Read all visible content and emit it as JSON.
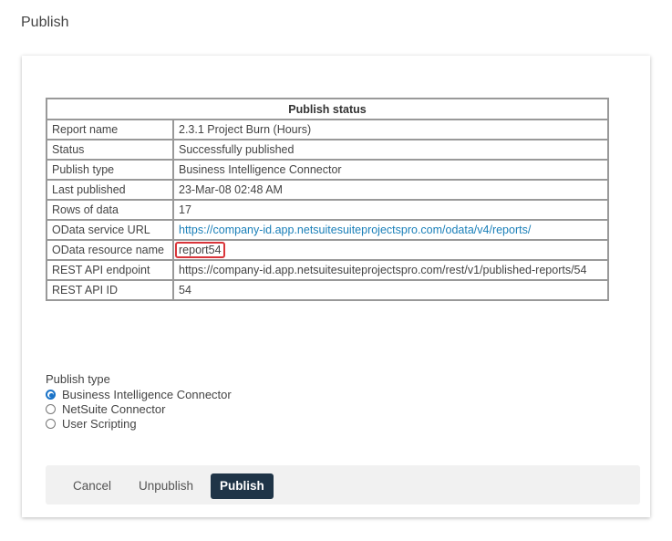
{
  "page": {
    "title": "Publish"
  },
  "status_table": {
    "caption": "Publish status",
    "rows": [
      {
        "label": "Report name",
        "value": "2.3.1 Project Burn (Hours)"
      },
      {
        "label": "Status",
        "value": "Successfully published"
      },
      {
        "label": "Publish type",
        "value": "Business Intelligence Connector"
      },
      {
        "label": "Last published",
        "value": "23-Mar-08 02:48 AM"
      },
      {
        "label": "Rows of data",
        "value": "17"
      },
      {
        "label": "OData service URL",
        "value": "https://company-id.app.netsuitesuiteprojectspro.com/odata/v4/reports/"
      },
      {
        "label": "OData resource name",
        "value": "report54"
      },
      {
        "label": "REST API endpoint",
        "value": "https://company-id.app.netsuitesuiteprojectspro.com/rest/v1/published-reports/54"
      },
      {
        "label": "REST API ID",
        "value": "54"
      }
    ]
  },
  "publish_type": {
    "legend": "Publish type",
    "options": [
      {
        "label": "Business Intelligence Connector",
        "checked": true
      },
      {
        "label": "NetSuite Connector",
        "checked": false
      },
      {
        "label": "User Scripting",
        "checked": false
      }
    ]
  },
  "footer": {
    "cancel_label": "Cancel",
    "unpublish_label": "Unpublish",
    "publish_label": "Publish"
  },
  "colors": {
    "link": "#1a7fb8",
    "highlight_border": "#d9353a",
    "radio_accent": "#1a73c8",
    "publish_button_bg": "#1f3447"
  }
}
